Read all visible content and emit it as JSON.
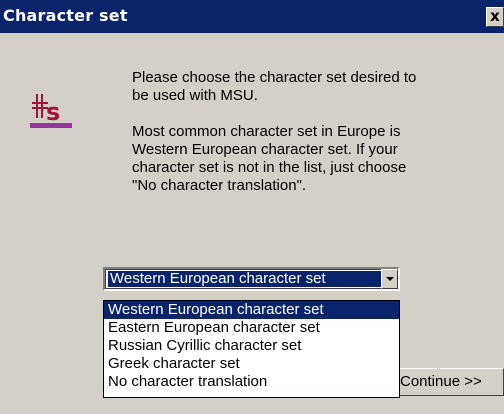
{
  "window": {
    "title": "Character set",
    "close_label": "x"
  },
  "message": {
    "paragraph1": "Please choose the character set desired to be used with MSU.",
    "paragraph2": "Most common character set in Europe is Western European character set. If your character set is not in the list, just choose \"No character translation\"."
  },
  "logo": {
    "icon": "msu-logo-icon",
    "text": "s",
    "accent_color": "#a0143c"
  },
  "charset_select": {
    "selected": "Western European character set",
    "options": [
      "Western European character set",
      "Eastern European character set",
      "Russian Cyrillic character set",
      "Greek character set",
      "No character translation"
    ]
  },
  "buttons": {
    "continue_label": "Continue >>"
  },
  "colors": {
    "title_bar": "#0a246a",
    "dialog_bg": "#d4d0c8",
    "selection": "#0a246a"
  }
}
